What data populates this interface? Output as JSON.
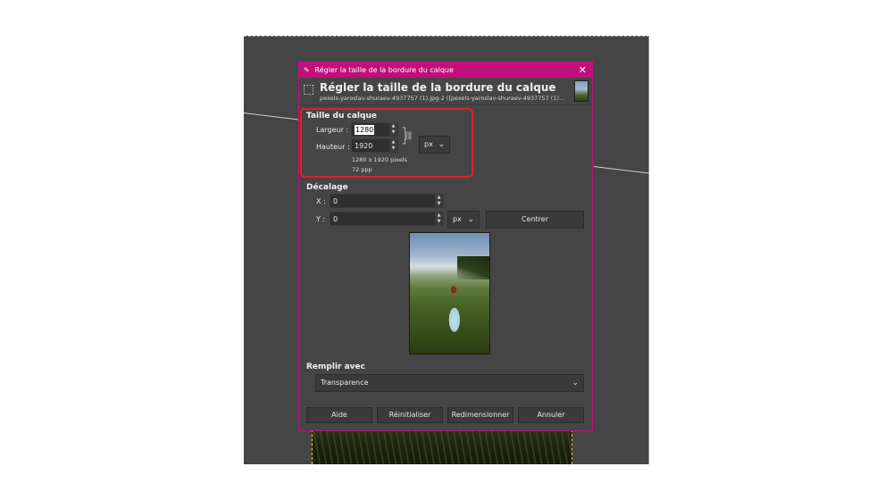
{
  "window": {
    "title": "Régler la taille de la bordure du calque",
    "close_glyph": "✕"
  },
  "header": {
    "title": "Régler la taille de la bordure du calque",
    "subtitle": "pexels-yaroslav-shuraev-4937757 (1).jpg-2 ([pexels-yaroslav-shuraev-4937757 (1)...",
    "icon": "layer-resize-icon"
  },
  "layer_size": {
    "label": "Taille du calque",
    "width_label": "Largeur :",
    "width_value": "1280",
    "height_label": "Hauteur :",
    "height_value": "1920",
    "unit": "px",
    "size_info": "1280 x 1920 pixels",
    "resolution_info": "72 ppp",
    "chain_icon": "chain-link-icon"
  },
  "offset": {
    "label": "Décalage",
    "x_label": "X :",
    "x_value": "0",
    "y_label": "Y :",
    "y_value": "0",
    "unit": "px",
    "center_label": "Centrer"
  },
  "fill": {
    "label": "Remplir avec",
    "value": "Transparence"
  },
  "buttons": {
    "help": "Aide",
    "reset": "Réinitialiser",
    "resize": "Redimensionner",
    "cancel": "Annuler"
  },
  "colors": {
    "titlebar": "#c0107c",
    "dialog_bg": "#454545",
    "highlight": "#e0202a"
  }
}
